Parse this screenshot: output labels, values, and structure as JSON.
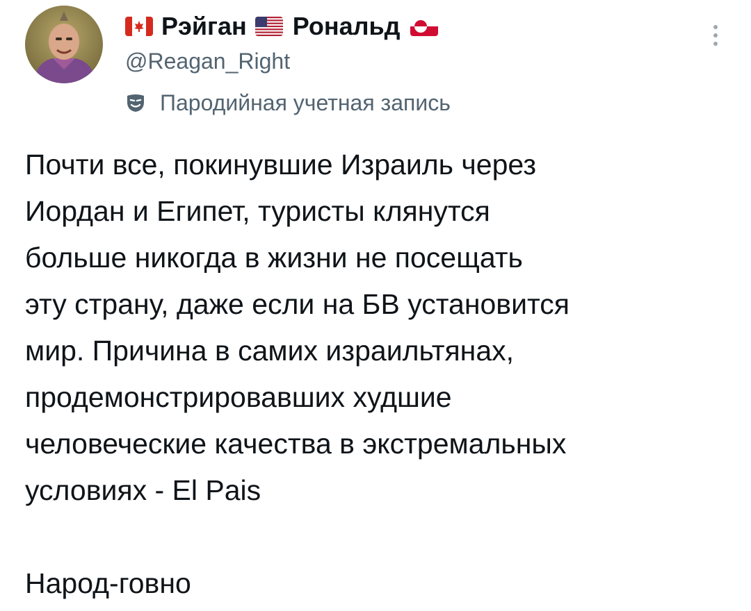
{
  "tweet": {
    "author": {
      "name_part1": "Рэйган",
      "name_part2": "Рональд",
      "flags": [
        "canada-flag-icon",
        "us-flag-icon",
        "greenland-flag-icon"
      ],
      "handle": "@Reagan_Right",
      "label_icon": "theater-mask-icon",
      "label": "Пародийная учетная запись"
    },
    "more_icon": "more-vertical-icon",
    "lines": [
      "Почти все, покинувшие Израиль через",
      "Иордан и Египет, туристы клянутся",
      "больше никогда в жизни не посещать",
      "эту страну, даже если на БВ установится",
      "мир. Причина в самих израильтянах,",
      "продемонстрировавших худшие",
      "человеческие качества в экстремальных",
      "условиях - El Pais"
    ],
    "closing": "Народ-говно"
  },
  "colors": {
    "text_primary": "#0f1419",
    "text_secondary": "#536471",
    "background": "#ffffff"
  }
}
